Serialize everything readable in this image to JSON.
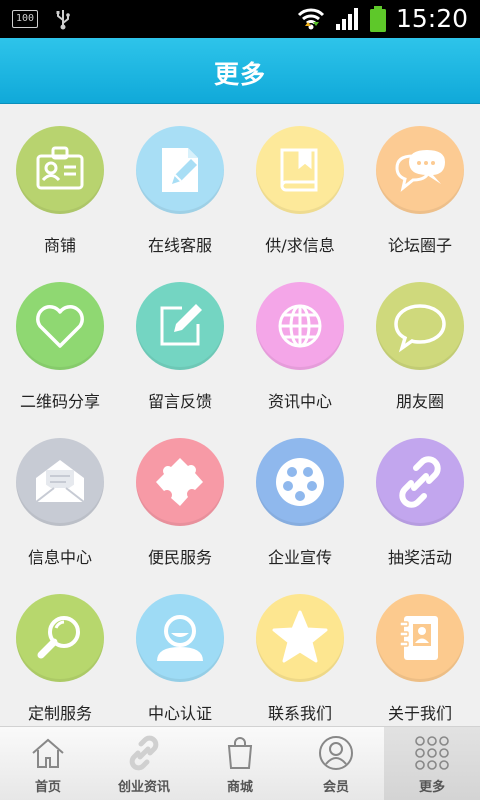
{
  "status_bar": {
    "battery_level_text": "100",
    "time": "15:20",
    "battery_color": "#5ec82a",
    "icons": [
      "battery-100-icon",
      "usb-icon",
      "wifi-icon",
      "signal-icon",
      "battery-icon"
    ]
  },
  "header": {
    "title": "更多"
  },
  "grid": {
    "items": [
      {
        "label": "商铺",
        "icon": "id-card-icon",
        "color": "#b8d36f"
      },
      {
        "label": "在线客服",
        "icon": "document-edit-icon",
        "color": "#a8def5"
      },
      {
        "label": "供/求信息",
        "icon": "book-icon",
        "color": "#fde99a"
      },
      {
        "label": "论坛圈子",
        "icon": "chat-bubbles-icon",
        "color": "#fccb93"
      },
      {
        "label": "二维码分享",
        "icon": "heart-icon",
        "color": "#8fd872"
      },
      {
        "label": "留言反馈",
        "icon": "edit-icon",
        "color": "#74d5c2"
      },
      {
        "label": "资讯中心",
        "icon": "globe-icon",
        "color": "#f4a6e8"
      },
      {
        "label": "朋友圈",
        "icon": "speech-bubble-icon",
        "color": "#cfd97c"
      },
      {
        "label": "信息中心",
        "icon": "envelope-icon",
        "color": "#c7cbd4"
      },
      {
        "label": "便民服务",
        "icon": "puzzle-icon",
        "color": "#f79aa6"
      },
      {
        "label": "企业宣传",
        "icon": "film-reel-icon",
        "color": "#8fb8ed"
      },
      {
        "label": "抽奖活动",
        "icon": "link-icon",
        "color": "#c2a6ee"
      },
      {
        "label": "定制服务",
        "icon": "magnifier-icon",
        "color": "#b7d76d"
      },
      {
        "label": "中心认证",
        "icon": "user-icon",
        "color": "#9edbf5"
      },
      {
        "label": "联系我们",
        "icon": "star-icon",
        "color": "#fde690"
      },
      {
        "label": "关于我们",
        "icon": "contacts-book-icon",
        "color": "#fcca8e"
      }
    ]
  },
  "bottom_nav": {
    "items": [
      {
        "label": "首页",
        "icon": "home-icon",
        "active": false
      },
      {
        "label": "创业资讯",
        "icon": "link-icon",
        "active": false
      },
      {
        "label": "商城",
        "icon": "shopping-bag-icon",
        "active": false
      },
      {
        "label": "会员",
        "icon": "user-circle-icon",
        "active": false
      },
      {
        "label": "更多",
        "icon": "grid-dots-icon",
        "active": true
      }
    ]
  }
}
